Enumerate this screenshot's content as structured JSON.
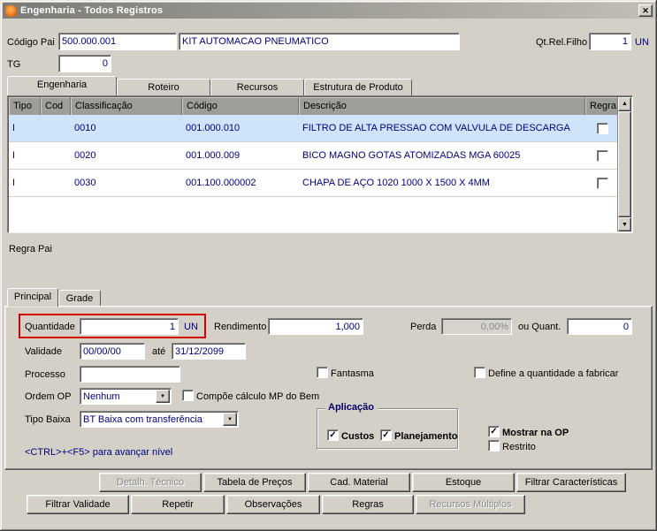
{
  "window": {
    "title": "Engenharia - Todos Registros"
  },
  "icons": {
    "close": "✕",
    "scroll_up": "▲",
    "scroll_down": "▼",
    "dropdown_arrow": "▼",
    "checkmark": "✓"
  },
  "colors": {
    "accent_text": "#000080",
    "selected_row": "#cfe3fa",
    "highlight_box": "#d40000",
    "dialog_bg": "#d4d0c8"
  },
  "header": {
    "codigo_pai_label": "Código Pai",
    "codigo_pai_value": "500.000.001",
    "descricao_value": "KIT AUTOMACAO PNEUMATICO",
    "qt_rel_filho_label": "Qt.Rel.Filho",
    "qt_rel_filho_value": "1",
    "qt_rel_filho_unit": "UN",
    "tg_label": "TG",
    "tg_value": "0"
  },
  "tabs": [
    {
      "label": "Engenharia",
      "active": true
    },
    {
      "label": "Roteiro",
      "active": false
    },
    {
      "label": "Recursos",
      "active": false
    },
    {
      "label": "Estrutura de Produto",
      "active": false
    }
  ],
  "table": {
    "columns": [
      "Tipo",
      "Cod",
      "Classificação",
      "Código",
      "Descrição",
      "Regra"
    ],
    "rows": [
      {
        "tipo": "I",
        "cod": "",
        "classificacao": "0010",
        "codigo": "001.000.010",
        "descricao": "FILTRO DE ALTA PRESSAO COM VALVULA DE DESCARGA",
        "regra_checked": false,
        "selected": true
      },
      {
        "tipo": "I",
        "cod": "",
        "classificacao": "0020",
        "codigo": "001.000.009",
        "descricao": "BICO MAGNO GOTAS ATOMIZADAS MGA 60025",
        "regra_checked": false,
        "selected": false
      },
      {
        "tipo": "I",
        "cod": "",
        "classificacao": "0030",
        "codigo": "001.100.000002",
        "descricao": "CHAPA DE AÇO 1020 1000 X 1500 X 4MM",
        "regra_checked": false,
        "selected": false
      }
    ]
  },
  "regra_pai_label": "Regra Pai",
  "detail_tabs": [
    {
      "label": "Principal",
      "active": true
    },
    {
      "label": "Grade",
      "active": false
    }
  ],
  "principal": {
    "quantidade_label": "Quantidade",
    "quantidade_value": "1",
    "quantidade_unit": "UN",
    "rendimento_label": "Rendimento",
    "rendimento_value": "1,000",
    "perda_label": "Perda",
    "perda_value": "0,00%",
    "ou_quant_label": "ou Quant.",
    "ou_quant_value": "0",
    "validade_label": "Validade",
    "validade_value": "00/00/00",
    "ate_label": "até",
    "ate_value": "31/12/2099",
    "processo_label": "Processo",
    "processo_value": "",
    "fantasma_label": "Fantasma",
    "fantasma_checked": false,
    "define_label": "Define a quantidade a fabricar",
    "define_checked": false,
    "ordem_op_label": "Ordem OP",
    "ordem_op_value": "Nenhum",
    "compoe_label": "Compõe cálculo MP do Bem",
    "compoe_checked": false,
    "tipo_baixa_label": "Tipo Baixa",
    "tipo_baixa_value": "BT Baixa com transferência",
    "aplicacao_label": "Aplicação",
    "custos_label": "Custos",
    "custos_checked": true,
    "planejamento_label": "Planejamento",
    "planejamento_checked": true,
    "mostrar_na_op_label": "Mostrar na OP",
    "mostrar_na_op_checked": true,
    "restrito_label": "Restrito",
    "restrito_checked": false,
    "hint": "<CTRL>+<F5> para avançar nível"
  },
  "buttons": {
    "row1": [
      {
        "label": "Detalh. Técnico",
        "disabled": true
      },
      {
        "label": "Tabela de Preços",
        "disabled": false
      },
      {
        "label": "Cad. Material",
        "disabled": false
      },
      {
        "label": "Estoque",
        "disabled": false
      },
      {
        "label": "Filtrar Características",
        "disabled": false
      }
    ],
    "row2": [
      {
        "label": "Filtrar Validade",
        "disabled": false
      },
      {
        "label": "Repetir",
        "disabled": false
      },
      {
        "label": "Observações",
        "disabled": false
      },
      {
        "label": "Regras",
        "disabled": false
      },
      {
        "label": "Recursos Múltiplos",
        "disabled": true
      }
    ]
  }
}
